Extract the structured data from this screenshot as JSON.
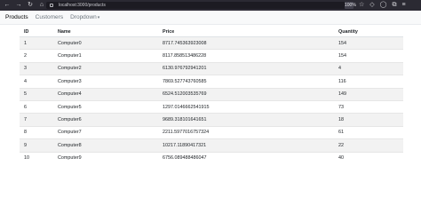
{
  "browser": {
    "url": "localhost:3000/products",
    "zoom": "100%"
  },
  "navbar": {
    "brand": "Products",
    "links": [
      "Customers"
    ],
    "dropdown": "Dropdown"
  },
  "table": {
    "headers": [
      "ID",
      "Name",
      "Price",
      "Quantity"
    ],
    "rows": [
      [
        "1",
        "Computer0",
        "8717.745363923008",
        "154"
      ],
      [
        "2",
        "Computer1",
        "8117.858513486228",
        "154"
      ],
      [
        "3",
        "Computer2",
        "6130.976792941201",
        "4"
      ],
      [
        "4",
        "Computer3",
        "7869.527743760585",
        "116"
      ],
      [
        "5",
        "Computer4",
        "6524.512003535769",
        "149"
      ],
      [
        "6",
        "Computer5",
        "1297.0146662541915",
        "73"
      ],
      [
        "7",
        "Computer6",
        "9689.318101641651",
        "18"
      ],
      [
        "8",
        "Computer7",
        "2211.5977016757324",
        "61"
      ],
      [
        "9",
        "Computer8",
        "10217.11890417321",
        "22"
      ],
      [
        "10",
        "Computer9",
        "6756.089488486047",
        "40"
      ]
    ]
  }
}
